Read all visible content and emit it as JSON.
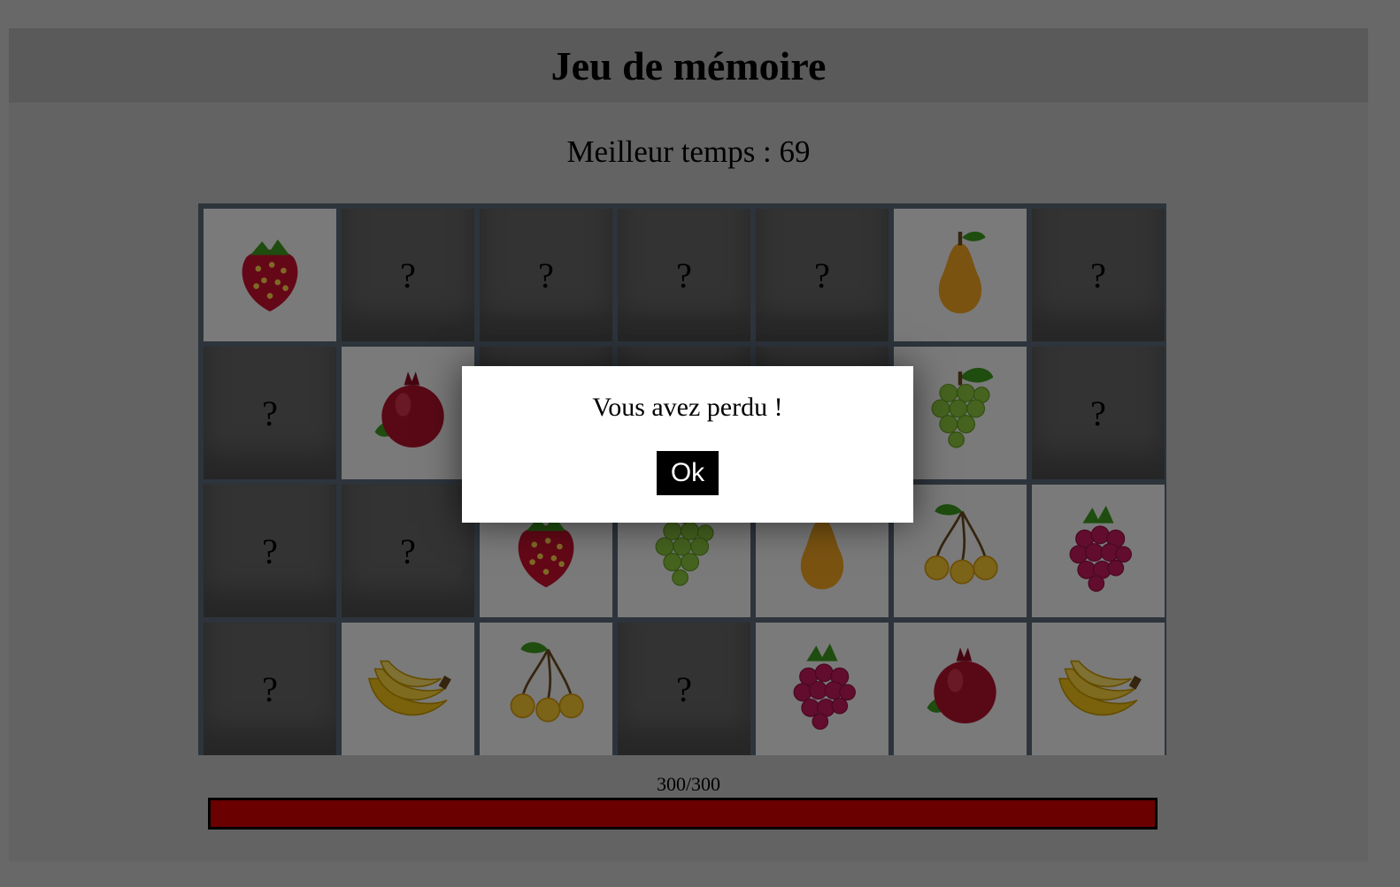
{
  "title": "Jeu de mémoire",
  "best_time_text": "Meilleur temps : 69",
  "hidden_symbol": "?",
  "cards": [
    "strawberry",
    "hidden",
    "hidden",
    "hidden",
    "hidden",
    "pear",
    "hidden",
    "hidden",
    "pomegranate",
    "hidden",
    "hidden",
    "hidden",
    "grapes",
    "hidden",
    "hidden",
    "hidden",
    "strawberry",
    "grapes",
    "pear",
    "cherries",
    "raspberry",
    "hidden",
    "banana",
    "cherries",
    "hidden",
    "raspberry",
    "pomegranate",
    "banana"
  ],
  "progress": {
    "label": "300/300",
    "value": 300,
    "max": 300,
    "color": "#d60000"
  },
  "modal": {
    "message": "Vous avez perdu !",
    "ok_label": "Ok"
  }
}
